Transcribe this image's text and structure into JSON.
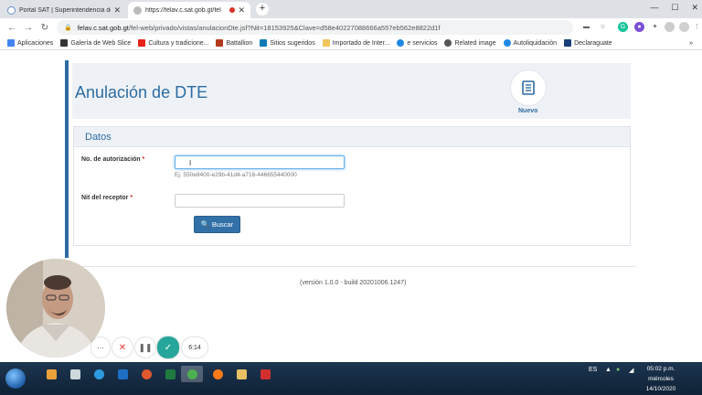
{
  "browser": {
    "tabs": [
      {
        "title": "Portal SAT | Superintendencia de",
        "active": false
      },
      {
        "title": "https://felav.c.sat.gob.gt/fel",
        "active": true
      }
    ],
    "url_host": "felav.c.sat.gob.gt",
    "url_path": "/fel-web/privado/vistas/anulacionDte.jsf?Nit=18153925&Clave=d58e40227088666a557eb562e8822d1f",
    "bookmarks": [
      {
        "label": "Aplicaciones",
        "icon": "apps-grid-icon",
        "color": "#4285f4"
      },
      {
        "label": "Galería de Web Slice",
        "icon": "webslice-icon",
        "color": "#333333"
      },
      {
        "label": "Cultura y tradicione...",
        "icon": "youtube-icon",
        "color": "#e62117"
      },
      {
        "label": "Battallion",
        "icon": "battallion-icon",
        "color": "#b33a1c"
      },
      {
        "label": "Sitios sugeridos",
        "icon": "suggested-icon",
        "color": "#0a7bb5"
      },
      {
        "label": "Importado de Inter...",
        "icon": "folder-icon",
        "color": "#f1c65c"
      },
      {
        "label": "e servicios",
        "icon": "ie-icon",
        "color": "#1e88e5"
      },
      {
        "label": "Related image",
        "icon": "globe-icon",
        "color": "#555555"
      },
      {
        "label": "Autoliquidación",
        "icon": "ie-icon",
        "color": "#1e88e5"
      },
      {
        "label": "Declaraguate",
        "icon": "declaraguate-icon",
        "color": "#1a3d7c"
      }
    ],
    "more_bookmarks": "»"
  },
  "page": {
    "title": "Anulación de DTE",
    "nuevo_label": "Nuevo",
    "section_title": "Datos",
    "auth_label": "No. de autorización",
    "auth_value": "",
    "auth_hint": "Ej. 550e8400-e29b-41d4-a716-446655440000",
    "nit_label": "Nit del receptor",
    "nit_value": "",
    "required_mark": "*",
    "search_button": "Buscar",
    "version": "(versión 1.0.0 - build 20201006.1247)"
  },
  "recorder": {
    "timer": "6:14",
    "more": "···"
  },
  "taskbar": {
    "language": "ES",
    "time": "05:02 p.m.",
    "day": "miércoles",
    "date": "14/10/2020"
  },
  "colors": {
    "brand_blue": "#2d6ca2",
    "button_blue": "#3270a8",
    "confirm_teal": "#26a69a",
    "cancel_red": "#e53935"
  }
}
